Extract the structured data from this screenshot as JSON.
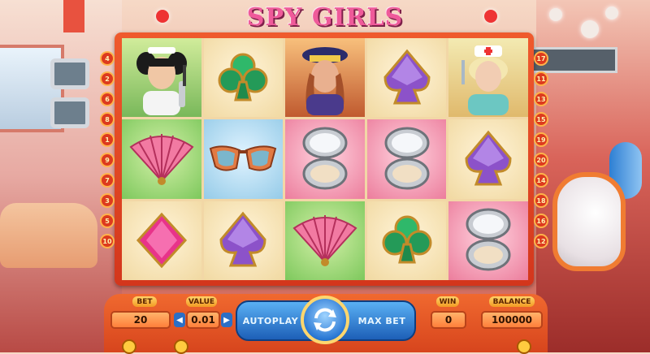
{
  "game": {
    "title": "SPY GIRLS"
  },
  "reels": [
    [
      "girl-pigtails-portrait",
      "club-gem",
      "police-girl-portrait",
      "spade-gem",
      "nurse-girl-portrait"
    ],
    [
      "pink-fan",
      "sunglasses",
      "compact-mirror",
      "compact-mirror",
      "spade-gem"
    ],
    [
      "pink-diamond-gem",
      "spade-gem",
      "pink-fan",
      "club-gem",
      "compact-mirror"
    ]
  ],
  "paylines": {
    "left": [
      "4",
      "2",
      "6",
      "8",
      "1",
      "9",
      "7",
      "3",
      "5",
      "10"
    ],
    "right": [
      "17",
      "11",
      "13",
      "15",
      "19",
      "20",
      "14",
      "18",
      "16",
      "12"
    ]
  },
  "controls": {
    "bet_label": "BET",
    "bet_value": "20",
    "value_label": "VALUE",
    "value_value": "0.01",
    "decrease_arrow": "◀",
    "increase_arrow": "▶",
    "autoplay_label": "AUTOPLAY",
    "max_bet_label": "MAX BET",
    "win_label": "WIN",
    "win_value": "0",
    "balance_label": "BALANCE",
    "balance_value": "100000"
  },
  "colors": {
    "accent": "#e8452a",
    "panel_blue": "#2a78d4",
    "gold": "#ffcf5a"
  }
}
